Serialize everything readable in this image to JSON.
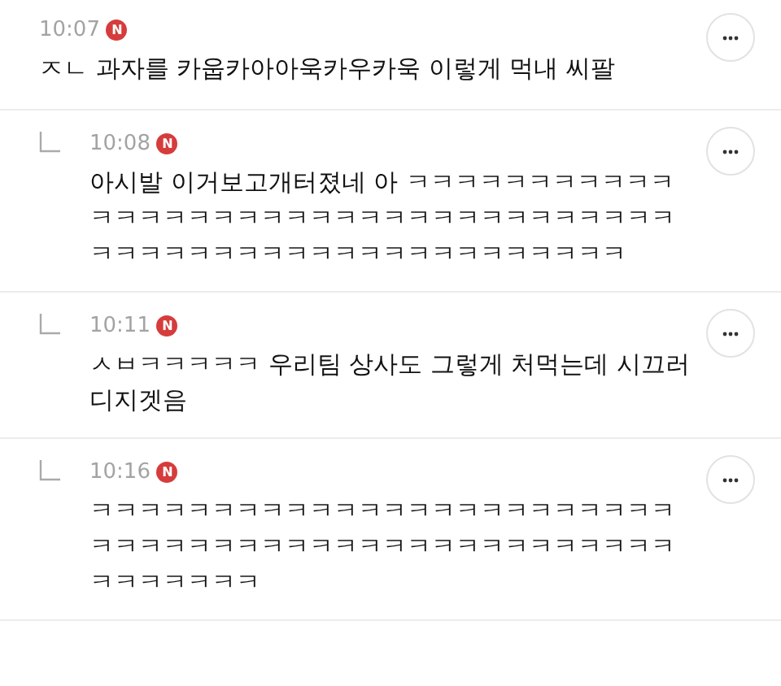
{
  "comments": [
    {
      "reply": false,
      "time": "10:07",
      "badge": "N",
      "text": "ㅈㄴ 과자를 카웁카아아욱카우카욱 이렇게 먹내 씨팔"
    },
    {
      "reply": true,
      "time": "10:08",
      "badge": "N",
      "text": "아시발 이거보고개터졌네 아 ㅋㅋㅋㅋㅋㅋㅋㅋㅋㅋㅋㅋㅋㅋㅋㅋㅋㅋㅋㅋㅋㅋㅋㅋㅋㅋㅋㅋㅋㅋㅋㅋㅋㅋㅋㅋㅋㅋㅋㅋㅋㅋㅋㅋㅋㅋㅋㅋㅋㅋㅋㅋㅋㅋㅋㅋㅋ"
    },
    {
      "reply": true,
      "time": "10:11",
      "badge": "N",
      "text": "ㅅㅂㅋㅋㅋㅋㅋ 우리팀 상사도 그렇게 처먹는데 시끄러 디지겟음"
    },
    {
      "reply": true,
      "time": "10:16",
      "badge": "N",
      "text": "ㅋㅋㅋㅋㅋㅋㅋㅋㅋㅋㅋㅋㅋㅋㅋㅋㅋㅋㅋㅋㅋㅋㅋㅋㅋㅋㅋㅋㅋㅋㅋㅋㅋㅋㅋㅋㅋㅋㅋㅋㅋㅋㅋㅋㅋㅋㅋㅋㅋㅋㅋㅋㅋㅋㅋ"
    }
  ]
}
